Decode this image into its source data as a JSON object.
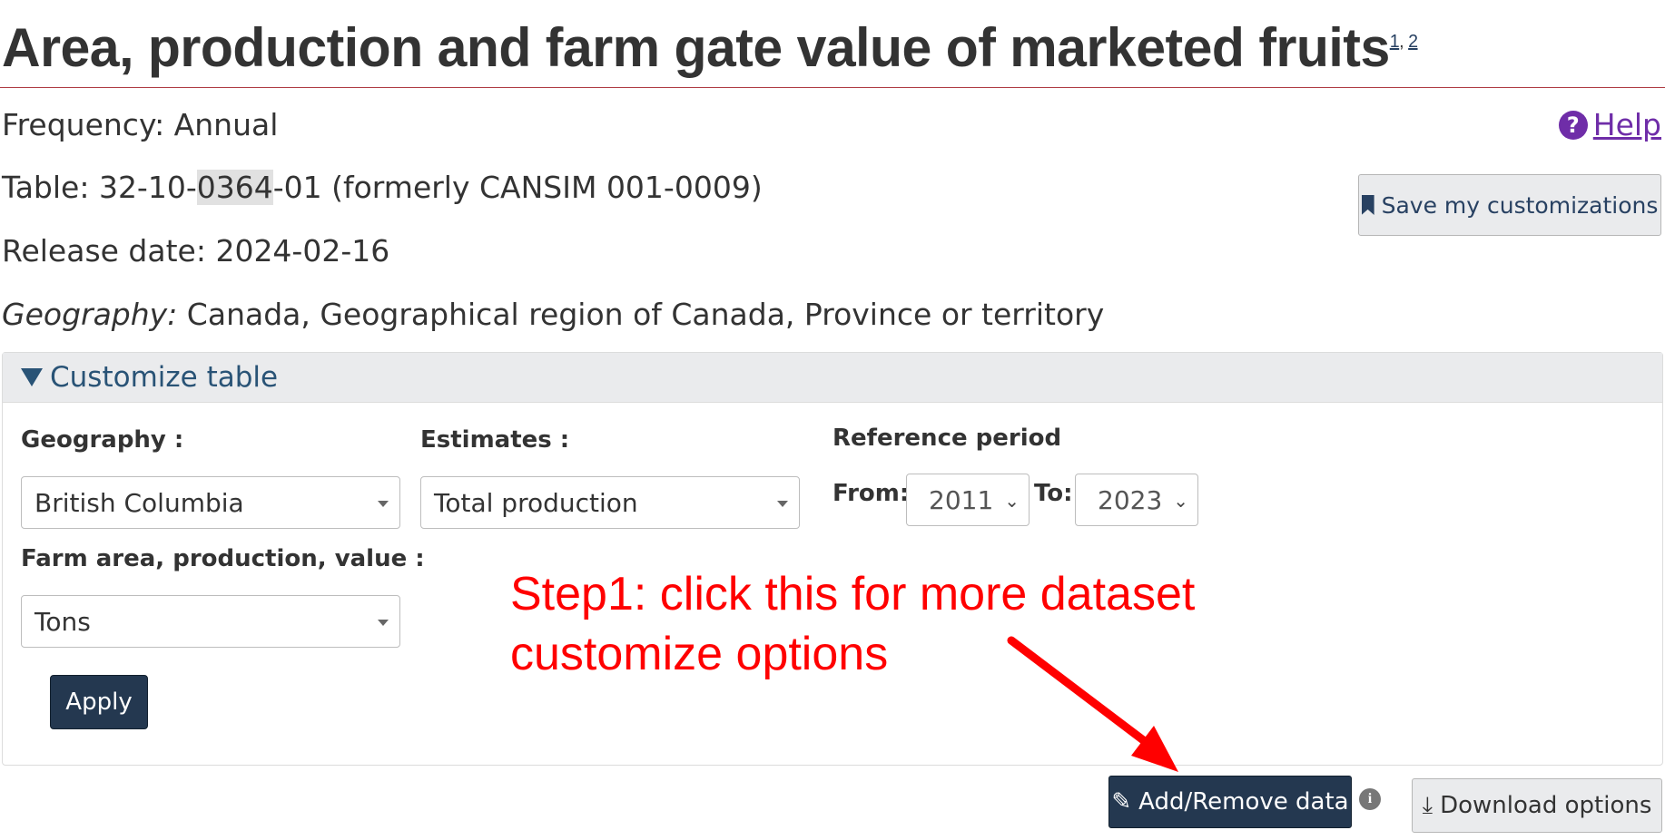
{
  "page": {
    "title": "Area, production and farm gate value of marketed fruits",
    "footnote_1": "1",
    "footnote_sep": ",",
    "footnote_2": "2",
    "frequency": "Frequency: Annual",
    "table_prefix": "Table: 32-10-",
    "table_highlight": "0364",
    "table_suffix": "-01 (formerly CANSIM 001-0009)",
    "release_date": "Release date: 2024-02-16",
    "geography_label": "Geography:",
    "geography_value": " Canada, Geographical region of Canada, Province or territory"
  },
  "help": {
    "label": "Help",
    "icon": "question-circle-icon"
  },
  "save_button": {
    "label": "Save my customizations",
    "icon": "bookmark-icon"
  },
  "customize": {
    "header": "Customize table",
    "geography": {
      "label": "Geography :",
      "selected": "British Columbia"
    },
    "estimates": {
      "label": "Estimates :",
      "selected": "Total production"
    },
    "reference_period": {
      "label": "Reference period",
      "from_label": "From:",
      "from_value": "2011",
      "to_label": "To:",
      "to_value": "2023"
    },
    "farm_area": {
      "label": "Farm area, production, value :",
      "selected": "Tons"
    },
    "apply_label": "Apply"
  },
  "annotation": {
    "text": "Step1: click this for more dataset customize options",
    "color": "#ff0000"
  },
  "actions": {
    "add_remove_label": "Add/Remove data",
    "add_remove_icon": "pencil-icon",
    "info_icon": "info-icon",
    "download_label": "Download options",
    "download_icon": "download-icon"
  },
  "colors": {
    "primary_button": "#243850",
    "link": "#284162",
    "help": "#6f2da8",
    "rule": "#af3c43"
  }
}
